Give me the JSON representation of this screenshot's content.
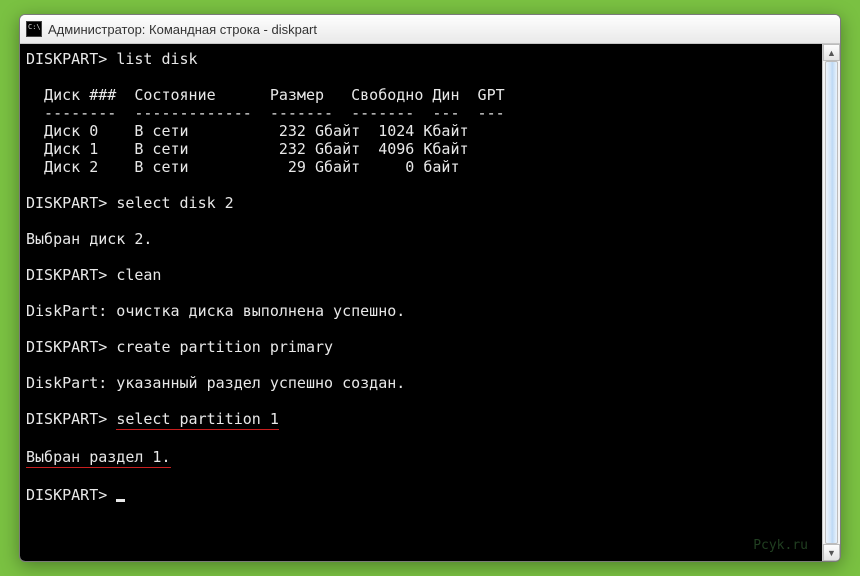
{
  "window": {
    "title": "Администратор: Командная строка - diskpart"
  },
  "terminal": {
    "prompt": "DISKPART>",
    "lines": [
      {
        "type": "cmd",
        "text": "list disk"
      },
      {
        "type": "blank"
      },
      {
        "type": "hdr",
        "text": "  Диск ###  Состояние      Размер   Свободно Дин  GPT"
      },
      {
        "type": "sep",
        "text": "  --------  -------------  -------  -------  ---  ---"
      },
      {
        "type": "row",
        "text": "  Диск 0    В сети          232 Gбайт  1024 Кбайт"
      },
      {
        "type": "row",
        "text": "  Диск 1    В сети          232 Gбайт  4096 Кбайт"
      },
      {
        "type": "row",
        "text": "  Диск 2    В сети           29 Gбайт     0 байт"
      },
      {
        "type": "blank"
      },
      {
        "type": "cmd",
        "text": "select disk 2"
      },
      {
        "type": "blank"
      },
      {
        "type": "out",
        "text": "Выбран диск 2."
      },
      {
        "type": "blank"
      },
      {
        "type": "cmd",
        "text": "clean"
      },
      {
        "type": "blank"
      },
      {
        "type": "out",
        "text": "DiskPart: очистка диска выполнена успешно."
      },
      {
        "type": "blank"
      },
      {
        "type": "cmd",
        "text": "create partition primary"
      },
      {
        "type": "blank"
      },
      {
        "type": "out",
        "text": "DiskPart: указанный раздел успешно создан."
      },
      {
        "type": "blank"
      },
      {
        "type": "cmd",
        "text": "select partition 1",
        "underline": true
      },
      {
        "type": "blank"
      },
      {
        "type": "out",
        "text": "Выбран раздел 1.",
        "underline": true
      },
      {
        "type": "blank"
      },
      {
        "type": "prompt"
      }
    ]
  },
  "watermark": "Pcyk.ru"
}
